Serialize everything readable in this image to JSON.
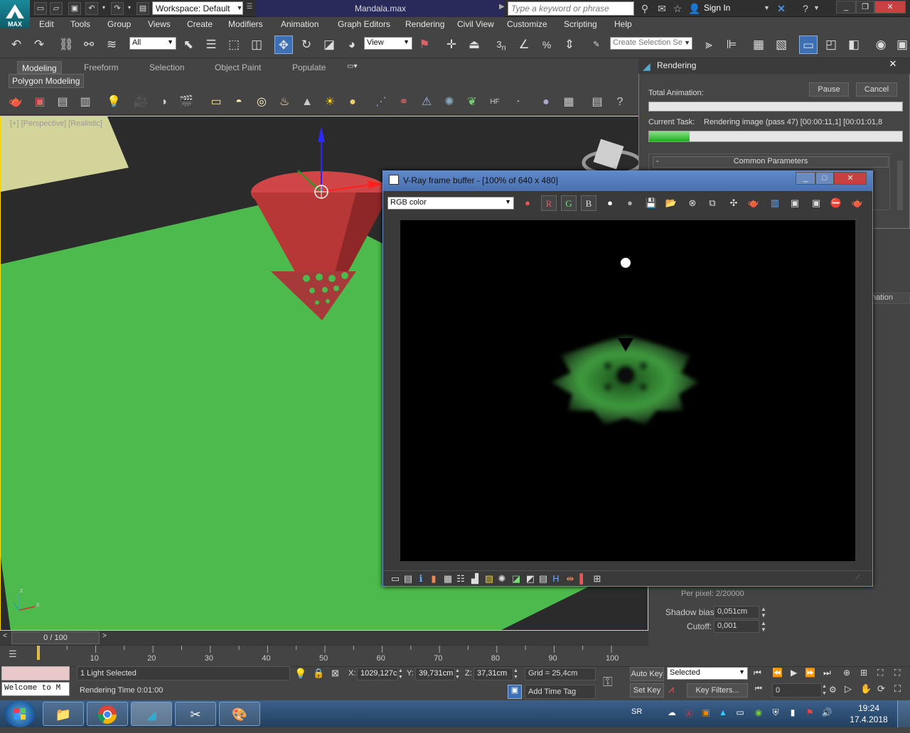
{
  "app": {
    "logo_label": "MAX",
    "workspace": "Workspace: Default",
    "title": "Mandala.max",
    "search_placeholder": "Type a keyword or phrase",
    "sign_in": "Sign In"
  },
  "menus": [
    "Edit",
    "Tools",
    "Group",
    "Views",
    "Create",
    "Modifiers",
    "Animation",
    "Graph Editors",
    "Rendering",
    "Civil View",
    "Customize",
    "Scripting",
    "Help"
  ],
  "toolbar": {
    "filter_value": "All",
    "refcoord_value": "View",
    "selection_set_placeholder": "Create Selection Se"
  },
  "ribbon": {
    "tabs": [
      "Modeling",
      "Freeform",
      "Selection",
      "Object Paint",
      "Populate"
    ],
    "panel": "Polygon Modeling"
  },
  "viewport": {
    "label": "[+] [Perspective] [Realistic]"
  },
  "rendering_dialog": {
    "title": "Rendering",
    "total_animation_label": "Total Animation:",
    "pause_label": "Pause",
    "cancel_label": "Cancel",
    "total_progress": 0,
    "current_task_label": "Current Task:",
    "current_task_value": "Rendering image (pass 47) [00:00:11,1] [00:01:01,8",
    "current_progress": 0.16,
    "section_label": "Common Parameters",
    "section_toggle": "-"
  },
  "right_panel": {
    "per_pixel": "Per pixel: 2/20000",
    "shadow_bias_label": "Shadow bias:",
    "shadow_bias_value": "0,051cm",
    "cutoff_label": "Cutoff:",
    "cutoff_value": "0,001",
    "animation_partial": "nation"
  },
  "vfb": {
    "title": "V-Ray frame buffer - [100% of 640 x 480]",
    "channel": "RGB color",
    "r_label": "R",
    "g_label": "G",
    "b_label": "B"
  },
  "timeline": {
    "frame_display": "0 / 100",
    "ticks": [
      "10",
      "20",
      "30",
      "40",
      "50",
      "60",
      "70",
      "80",
      "90",
      "100"
    ]
  },
  "status": {
    "selected_text": "1 Light Selected",
    "rendering_time": "Rendering Time  0:01:00",
    "welcome": "Welcome to M",
    "x_label": "X:",
    "x_value": "1029,127c",
    "y_label": "Y:",
    "y_value": "39,731cm",
    "z_label": "Z:",
    "z_value": "37,31cm",
    "grid": "Grid = 25,4cm",
    "add_time_tag": "Add Time Tag",
    "auto_key": "Auto Key",
    "set_key": "Set Key",
    "selected_dropdown": "Selected",
    "key_filters": "Key Filters...",
    "frame_field": "0"
  },
  "taskbar": {
    "lang": "SR",
    "time": "19:24",
    "date": "17.4.2018"
  }
}
